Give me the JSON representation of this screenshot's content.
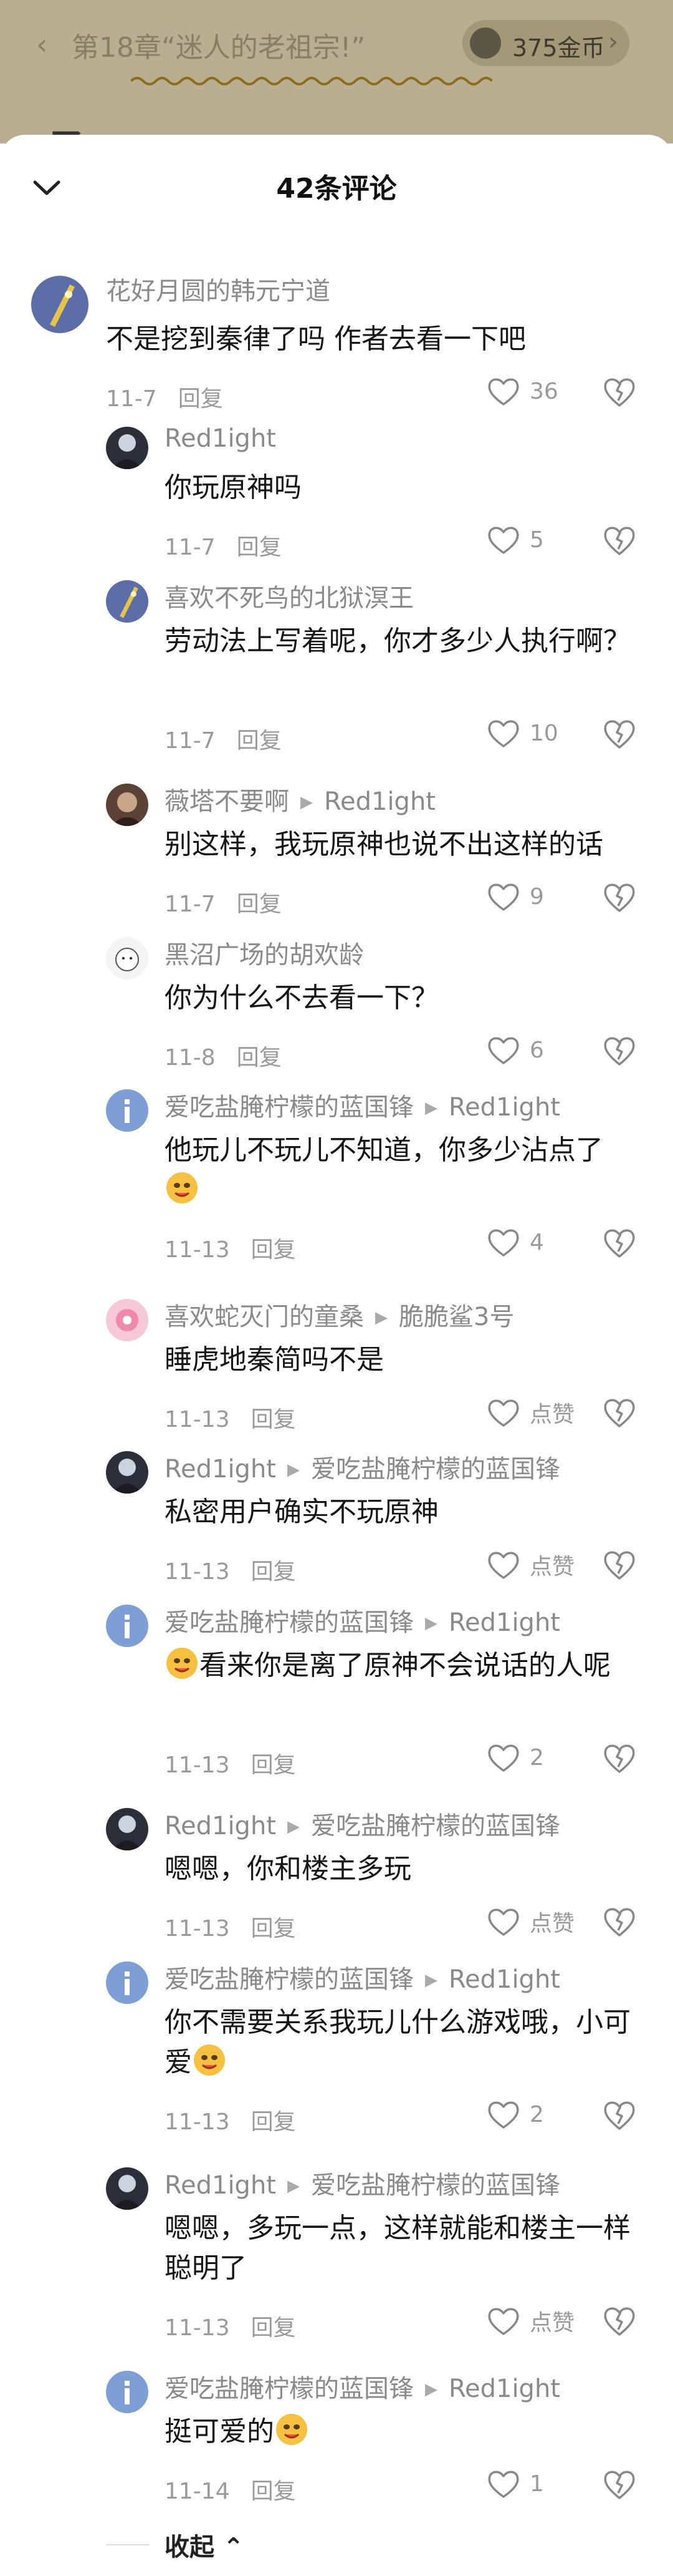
{
  "topbar": {
    "chapter_title": "第18章“迷人的老祖宗!”",
    "coins": "375金币",
    "peek_text": "了..."
  },
  "sheet": {
    "title": "42条评论",
    "collapse_label": "收起"
  },
  "comments": [
    {
      "user": "花好月圆的韩元宁道",
      "text": "不是挖到秦律了吗 作者去看一下吧",
      "date": "11-7",
      "reply": "回复",
      "likes": "36"
    },
    {
      "user": "Red1ight",
      "text": "你玩原神吗",
      "date": "11-7",
      "reply": "回复",
      "likes": "5"
    },
    {
      "user": "喜欢不死鸟的北狱溟王",
      "text": "劳动法上写着呢，你才多少人执行啊？",
      "date": "11-7",
      "reply": "回复",
      "likes": "10"
    },
    {
      "user": "薇塔不要啊",
      "target": "Red1ight",
      "text": "别这样，我玩原神也说不出这样的话",
      "date": "11-7",
      "reply": "回复",
      "likes": "9"
    },
    {
      "user": "黑沼广场的胡欢龄",
      "text": "你为什么不去看一下？",
      "date": "11-8",
      "reply": "回复",
      "likes": "6"
    },
    {
      "user": "爱吃盐腌柠檬的蓝国锋",
      "target": "Red1ight",
      "text": "他玩儿不玩儿不知道，你多少沾点了",
      "date": "11-13",
      "reply": "回复",
      "likes": "4"
    },
    {
      "user": "喜欢蛇灭门的童桑",
      "target": "脆脆鲨3号",
      "text": "睡虎地秦简吗不是",
      "date": "11-13",
      "reply": "回复",
      "likes": "点赞"
    },
    {
      "user": "Red1ight",
      "target": "爱吃盐腌柠檬的蓝国锋",
      "text": "私密用户确实不玩原神",
      "date": "11-13",
      "reply": "回复",
      "likes": "点赞"
    },
    {
      "user": "爱吃盐腌柠檬的蓝国锋",
      "target": "Red1ight",
      "text": "看来你是离了原神不会说话的人呢",
      "date": "11-13",
      "reply": "回复",
      "likes": "2"
    },
    {
      "user": "Red1ight",
      "target": "爱吃盐腌柠檬的蓝国锋",
      "text": "嗯嗯，你和楼主多玩",
      "date": "11-13",
      "reply": "回复",
      "likes": "点赞"
    },
    {
      "user": "爱吃盐腌柠檬的蓝国锋",
      "target": "Red1ight",
      "text": "你不需要关系我玩儿什么游戏哦，小可爱",
      "date": "11-13",
      "reply": "回复",
      "likes": "2"
    },
    {
      "user": "Red1ight",
      "target": "爱吃盐腌柠檬的蓝国锋",
      "text": "嗯嗯，多玩一点，这样就能和楼主一样聪明了",
      "date": "11-13",
      "reply": "回复",
      "likes": "点赞"
    },
    {
      "user": "爱吃盐腌柠檬的蓝国锋",
      "target": "Red1ight",
      "text": "挺可爱的",
      "date": "11-14",
      "reply": "回复",
      "likes": "1"
    }
  ]
}
